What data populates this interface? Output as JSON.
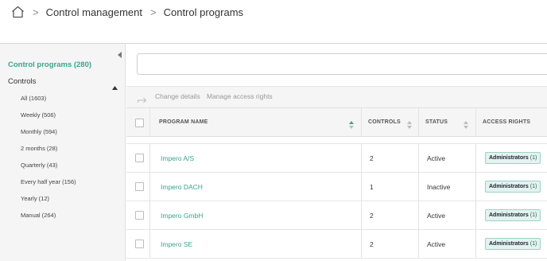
{
  "breadcrumb": {
    "home_icon": "home-icon",
    "items": [
      "Control management",
      "Control programs"
    ]
  },
  "sidebar": {
    "collapse_icon": "chevron-left-icon",
    "title": "Control programs (280)",
    "section_label": "Controls",
    "section_icon": "chevron-up-icon",
    "items": [
      {
        "label": "All (1603)"
      },
      {
        "label": "Weekly (506)"
      },
      {
        "label": "Monthly (594)"
      },
      {
        "label": "2 months (28)"
      },
      {
        "label": "Quarterly (43)"
      },
      {
        "label": "Every half year (156)"
      },
      {
        "label": "Yearly (12)"
      },
      {
        "label": "Manual (264)"
      }
    ]
  },
  "search": {
    "placeholder": "",
    "value": ""
  },
  "toolbar": {
    "move_icon": "move-arrow-icon",
    "change_details": "Change details",
    "manage_access": "Manage access rights"
  },
  "table": {
    "headers": {
      "program_name": "PROGRAM NAME",
      "controls": "CONTROLS",
      "status": "STATUS",
      "access_rights": "ACCESS RIGHTS"
    },
    "rows": [
      {
        "name": "Impero A/S",
        "controls": "2",
        "status": "Active",
        "access": "Administrators",
        "access_count": "(1)"
      },
      {
        "name": "Impero DACH",
        "controls": "1",
        "status": "Inactive",
        "access": "Administrators",
        "access_count": "(1)"
      },
      {
        "name": "Impero GmbH",
        "controls": "2",
        "status": "Active",
        "access": "Administrators",
        "access_count": "(1)"
      },
      {
        "name": "Impero SE",
        "controls": "2",
        "status": "Active",
        "access": "Administrators",
        "access_count": "(1)"
      }
    ]
  },
  "colors": {
    "accent": "#3aa58a",
    "badge_bg": "#e3f3ef",
    "sidebar_bg": "#f5f5f5"
  }
}
